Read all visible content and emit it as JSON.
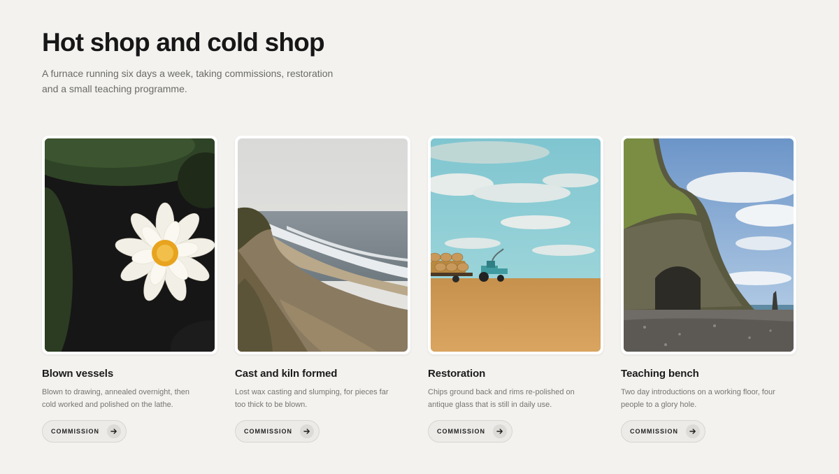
{
  "header": {
    "title": "Hot shop and cold shop",
    "subtitle": "A furnace running six days a week, taking commissions, restoration and a small teaching programme."
  },
  "cards": [
    {
      "title": "Blown vessels",
      "description": "Blown to drawing, annealed overnight, then cold worked and polished on the lathe.",
      "button_label": "COMMISSION",
      "image": "water-lily-photo"
    },
    {
      "title": "Cast and kiln formed",
      "description": "Lost wax casting and slumping, for pieces far too thick to be blown.",
      "button_label": "COMMISSION",
      "image": "coastal-cliff-photo"
    },
    {
      "title": "Restoration",
      "description": "Chips ground back and rims re-polished on antique glass that is still in daily use.",
      "button_label": "COMMISSION",
      "image": "tractor-field-photo"
    },
    {
      "title": "Teaching bench",
      "description": "Two day introductions on a working floor, four people to a glory hole.",
      "button_label": "COMMISSION",
      "image": "sea-cliff-beach-photo"
    }
  ],
  "icons": {
    "button_icon": "arrow-right-icon"
  }
}
